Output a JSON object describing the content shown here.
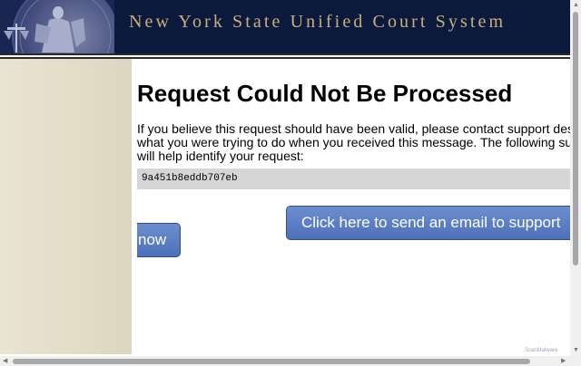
{
  "header": {
    "title": "New York State Unified Court System",
    "emblem_icon": "justice-statue-emblem"
  },
  "main": {
    "heading": "Request Could Not Be Processed",
    "message_lines": [
      "If you believe this request should have been valid, please contact support describing",
      "what you were trying to do when you received this message. The following support ID",
      "will help identify your request:"
    ],
    "support_id": "9a451b8eddb707eb",
    "email_button": {
      "line1": "Click here to send an email to support",
      "line2": "now"
    }
  },
  "watermark": "ScanMalware",
  "colors": {
    "header_bg": "#0b1a3c",
    "header_text": "#c8b07a",
    "sidebar_bg": "#e3dcc7",
    "button_bg": "#5a7cc4"
  }
}
